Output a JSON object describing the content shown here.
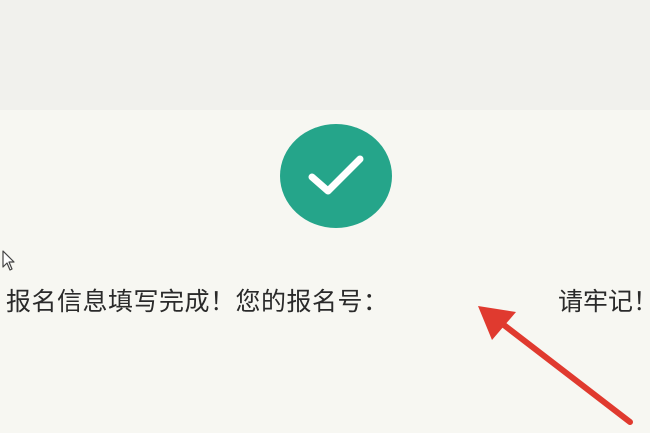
{
  "registration": {
    "status_icon": "check-icon",
    "message": "报名信息填写完成！您的报名号：",
    "registration_number": "",
    "remember_text": "请牢记！"
  },
  "colors": {
    "success": "#25a58a",
    "annotation_arrow": "#e03a2f",
    "background": "#f7f7f2"
  }
}
